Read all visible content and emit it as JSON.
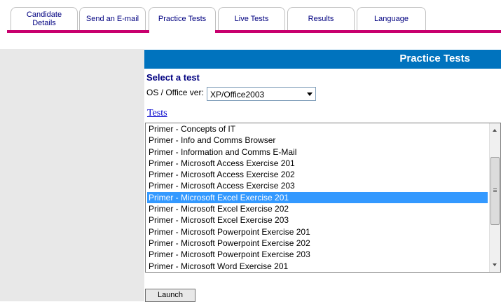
{
  "tabs": [
    {
      "label_line1": "Candidate",
      "label_line2": "Details"
    },
    {
      "label_line1": "Send an E-mail",
      "label_line2": ""
    },
    {
      "label_line1": "Practice Tests",
      "label_line2": ""
    },
    {
      "label_line1": "Live Tests",
      "label_line2": ""
    },
    {
      "label_line1": "Results",
      "label_line2": ""
    },
    {
      "label_line1": "Language",
      "label_line2": ""
    }
  ],
  "active_tab": "Practice Tests",
  "colors": {
    "accent_line": "#c8006e",
    "header_bar": "#0073be",
    "selection": "#3399ff",
    "tab_text": "#000080"
  },
  "panel": {
    "title": "Practice Tests",
    "select_label": "Select a test",
    "os_label": "OS / Office ver:",
    "os_value": "XP/Office2003",
    "tests_link": "Tests",
    "launch_label": "Launch"
  },
  "tests": [
    "Primer - Concepts of IT",
    "Primer - Info and Comms Browser",
    "Primer - Information and Comms E-Mail",
    "Primer - Microsoft Access Exercise 201",
    "Primer - Microsoft Access Exercise 202",
    "Primer - Microsoft Access Exercise 203",
    "Primer - Microsoft Excel Exercise 201",
    "Primer - Microsoft Excel Exercise 202",
    "Primer - Microsoft Excel Exercise 203",
    "Primer - Microsoft Powerpoint Exercise 201",
    "Primer - Microsoft Powerpoint Exercise 202",
    "Primer - Microsoft Powerpoint Exercise 203",
    "Primer - Microsoft Word Exercise 201"
  ],
  "selected_test": "Primer - Microsoft Excel Exercise 201",
  "icons": {
    "dropdown": "chevron-down-icon",
    "scroll_up": "scroll-up-arrow-icon",
    "scroll_down": "scroll-down-arrow-icon"
  }
}
